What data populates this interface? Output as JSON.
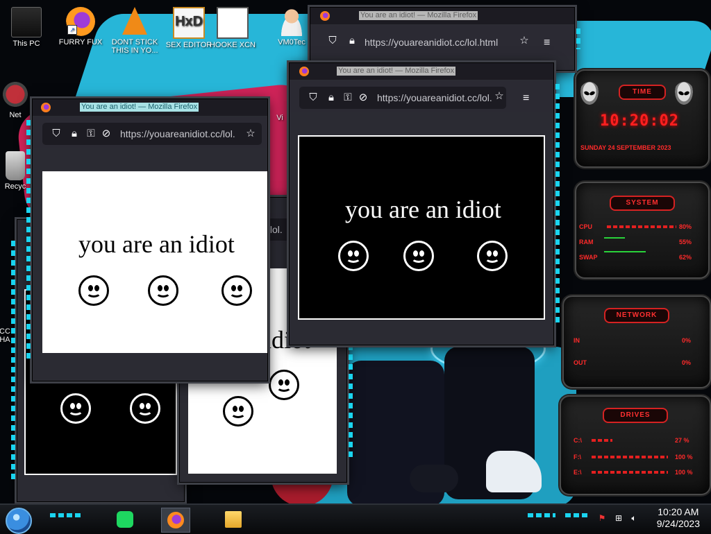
{
  "desktop_icons": [
    {
      "label": "This PC",
      "icon": "pc-icon"
    },
    {
      "label": "FURRY FUX",
      "icon": "firefox-icon"
    },
    {
      "label": "DONT STICK THIS IN YO...",
      "icon": "vlc-icon"
    },
    {
      "label": "SEX EDITOR",
      "icon": "hxd-icon"
    },
    {
      "label": "HOOKE XCN",
      "icon": "hook-icon"
    },
    {
      "label": "VM0Tec",
      "icon": "user-icon"
    },
    {
      "label": "Net",
      "icon": "network-icon"
    },
    {
      "label": "Recyc",
      "icon": "recycle-bin-icon"
    },
    {
      "label": "CC HA",
      "icon": "app-icon"
    },
    {
      "label": "Vi",
      "icon": "app-icon"
    }
  ],
  "windows": {
    "w1": {
      "title": "You are an idiot! — Mozilla Firefox",
      "url": "https://youareanidiot.cc/lol.html"
    },
    "w2": {
      "title": "You are an idiot! — Mozilla Firefox",
      "url": "https://youareanidiot.cc/lol.",
      "content_text": "you are an idiot"
    },
    "w3": {
      "title": "You are an idiot! — Mozilla Firefox",
      "url": "https://youareanidiot.cc/lol.",
      "content_text": "you are an idiot"
    },
    "w4": {
      "url": "/lol.",
      "content_text": "idiot"
    }
  },
  "widgets": {
    "time": {
      "header": "TIME",
      "time": "10:20:02",
      "date": "SUNDAY 24 SEPTEMBER 2023"
    },
    "system": {
      "header": "SYSTEM",
      "cpu_label": "CPU",
      "cpu_value": "80%",
      "ram_label": "RAM",
      "ram_value": "55%",
      "swap_label": "SWAP",
      "swap_value": "62%"
    },
    "network": {
      "header": "NETWORK",
      "in_label": "IN",
      "in_value": "0%",
      "out_label": "OUT",
      "out_value": "0%"
    },
    "drives": {
      "header": "DRIVES",
      "d1_label": "C:\\",
      "d1_value": "27 %",
      "d2_label": "F:\\",
      "d2_value": "100 %",
      "d3_label": "E:\\",
      "d3_value": "100 %"
    }
  },
  "taskbar": {
    "time": "10:20 AM",
    "date": "9/24/2023",
    "apps": [
      "spotify-icon",
      "firefox-icon",
      "file-explorer-icon"
    ]
  },
  "colors": {
    "accent_cyan": "#1ad4f0",
    "widget_red": "#ff2a2a",
    "firefox_title_active": "#a8e2e6"
  }
}
